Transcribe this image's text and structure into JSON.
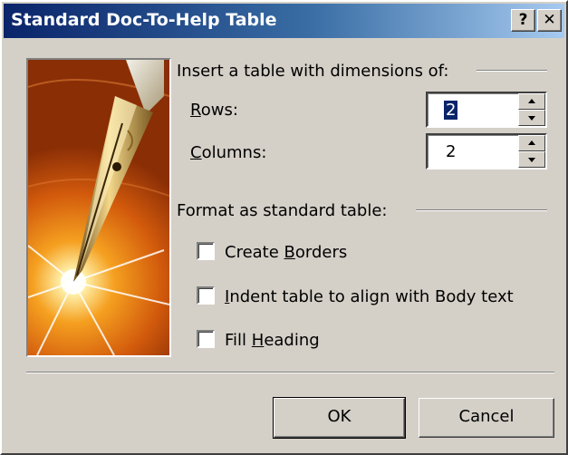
{
  "window": {
    "title": "Standard Doc-To-Help Table",
    "help_button": "?",
    "close_button": "✕",
    "titlebar_colors": [
      "#0a246a",
      "#a6caf0"
    ]
  },
  "dimensions": {
    "group_label": "Insert a table with dimensions of:",
    "rows": {
      "mnemonic": "R",
      "label_rest": "ows:",
      "value": "2"
    },
    "columns": {
      "mnemonic": "C",
      "label_rest": "olumns:",
      "value": "2"
    }
  },
  "format": {
    "group_label": "Format as standard table:",
    "checkboxes": [
      {
        "before": "Create ",
        "mnemonic": "B",
        "after": "orders",
        "checked": false
      },
      {
        "before": "",
        "mnemonic": "I",
        "after": "ndent table to align with Body text",
        "checked": false
      },
      {
        "before": "Fill ",
        "mnemonic": "H",
        "after": "eading",
        "checked": false
      }
    ]
  },
  "buttons": {
    "ok": "OK",
    "cancel": "Cancel"
  },
  "image": {
    "icon": "fountain-pen-nib-icon"
  }
}
